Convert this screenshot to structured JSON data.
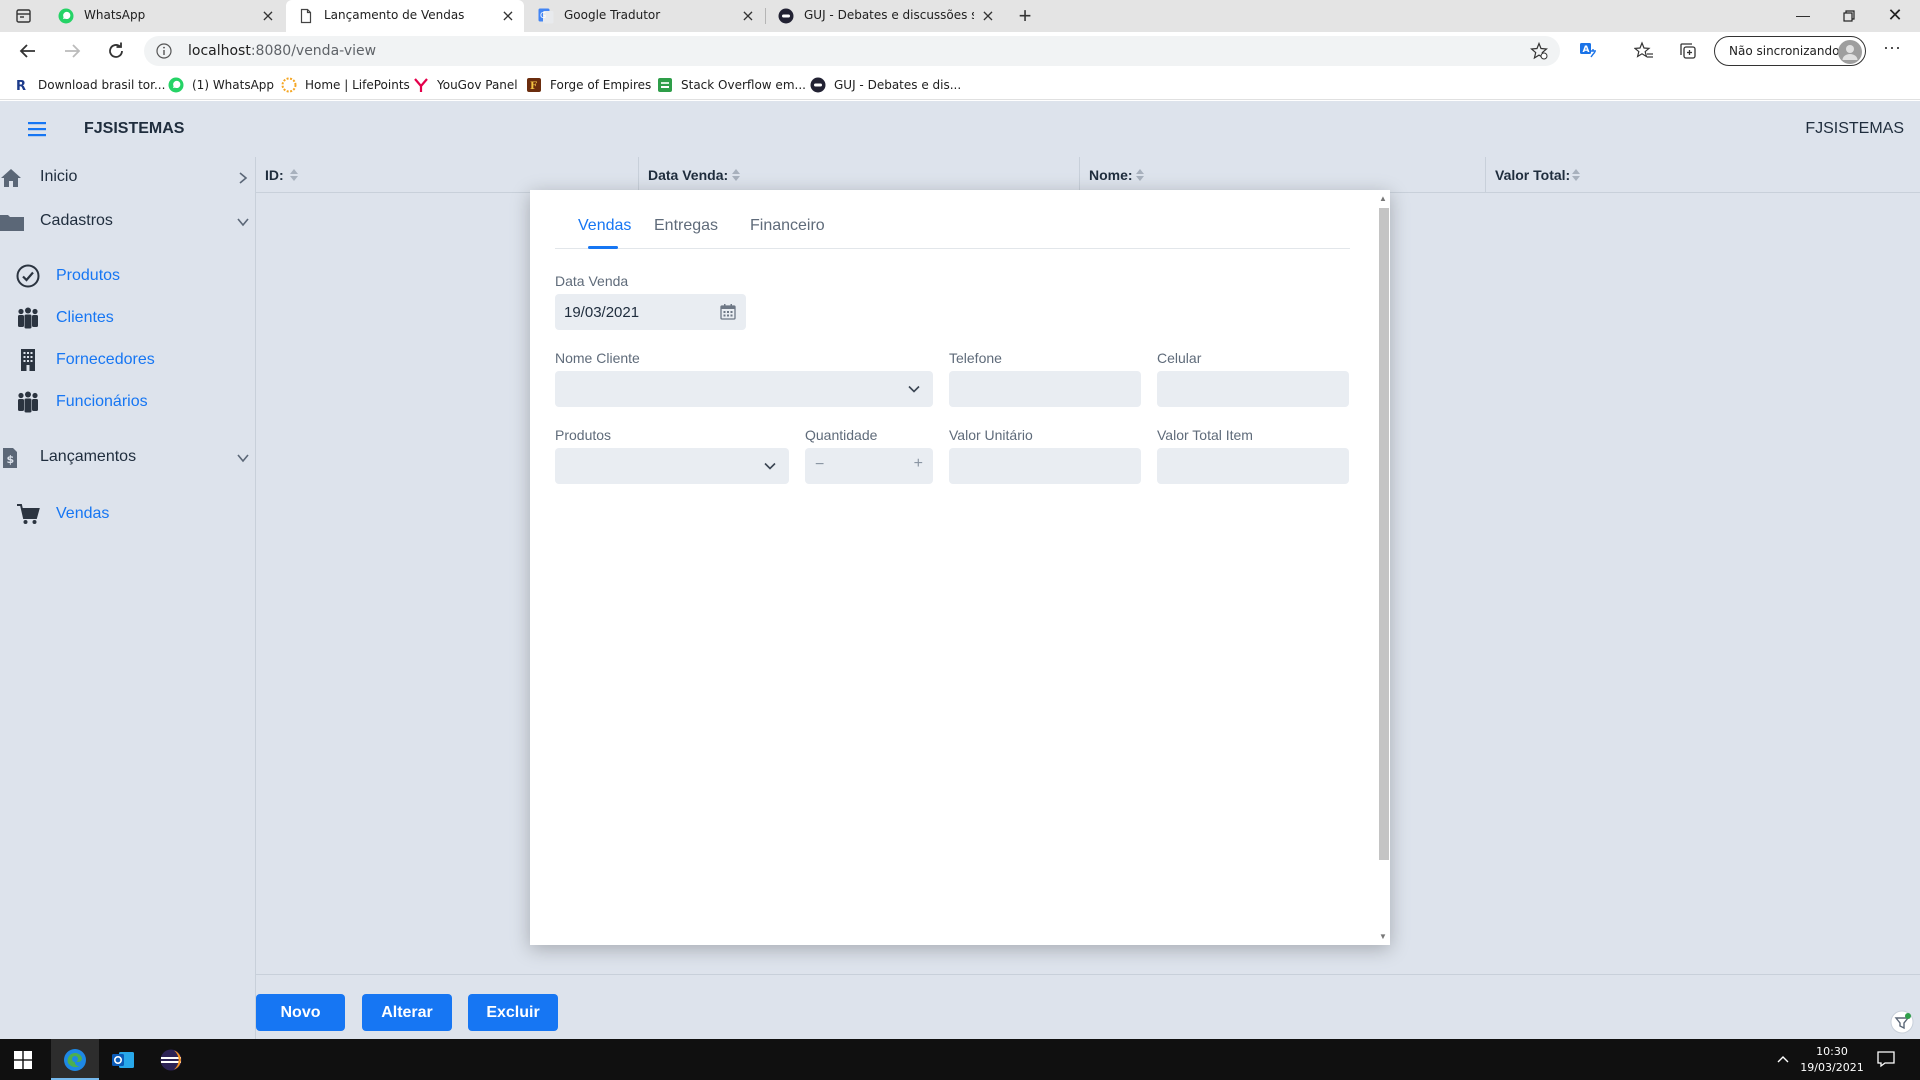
{
  "browser": {
    "tabs": [
      {
        "title": "WhatsApp",
        "icon": "whatsapp-icon",
        "active": false
      },
      {
        "title": "Lançamento de Vendas",
        "icon": "page-icon",
        "active": true
      },
      {
        "title": "Google Tradutor",
        "icon": "google-translate-icon",
        "active": false
      },
      {
        "title": "GUJ - Debates e discussões sobr",
        "icon": "guj-icon",
        "active": false
      }
    ],
    "url_host": "localhost",
    "url_path": ":8080/venda-view",
    "profile_label": "Não sincronizando",
    "bookmarks": [
      {
        "label": "Download brasil tor...",
        "icon": "r-icon"
      },
      {
        "label": "(1) WhatsApp",
        "icon": "whatsapp-icon"
      },
      {
        "label": "Home | LifePoints",
        "icon": "lifepoints-icon"
      },
      {
        "label": "YouGov Panel",
        "icon": "yougov-icon"
      },
      {
        "label": "Forge of Empires",
        "icon": "forge-icon"
      },
      {
        "label": "Stack Overflow em...",
        "icon": "stackoverflow-icon"
      },
      {
        "label": "GUJ - Debates e dis...",
        "icon": "guj-icon"
      }
    ]
  },
  "app": {
    "brand": "FJSISTEMAS",
    "brand_right": "FJSISTEMAS",
    "menu": {
      "inicio": "Inicio",
      "cadastros": "Cadastros",
      "cadastros_items": [
        "Produtos",
        "Clientes",
        "Fornecedores",
        "Funcionários"
      ],
      "lancamentos": "Lançamentos",
      "lancamentos_items": [
        "Vendas"
      ]
    },
    "grid": {
      "columns": [
        "ID:",
        "Data Venda:",
        "Nome:",
        "Valor Total:"
      ]
    },
    "buttons": {
      "novo": "Novo",
      "alterar": "Alterar",
      "excluir": "Excluir"
    }
  },
  "dialog": {
    "tabs": [
      "Vendas",
      "Entregas",
      "Financeiro"
    ],
    "active_tab": "Vendas",
    "fields": {
      "data_venda_label": "Data Venda",
      "data_venda_value": "19/03/2021",
      "nome_cliente_label": "Nome Cliente",
      "telefone_label": "Telefone",
      "celular_label": "Celular",
      "produtos_label": "Produtos",
      "quantidade_label": "Quantidade",
      "valor_unitario_label": "Valor Unitário",
      "valor_total_item_label": "Valor Total Item",
      "minus_symbol": "−",
      "plus_symbol": "+"
    }
  },
  "taskbar": {
    "time": "10:30",
    "date": "19/03/2021"
  },
  "colors": {
    "accent": "#1676f3",
    "app_background": "#dde3ec",
    "field_background": "#e9edf2"
  }
}
